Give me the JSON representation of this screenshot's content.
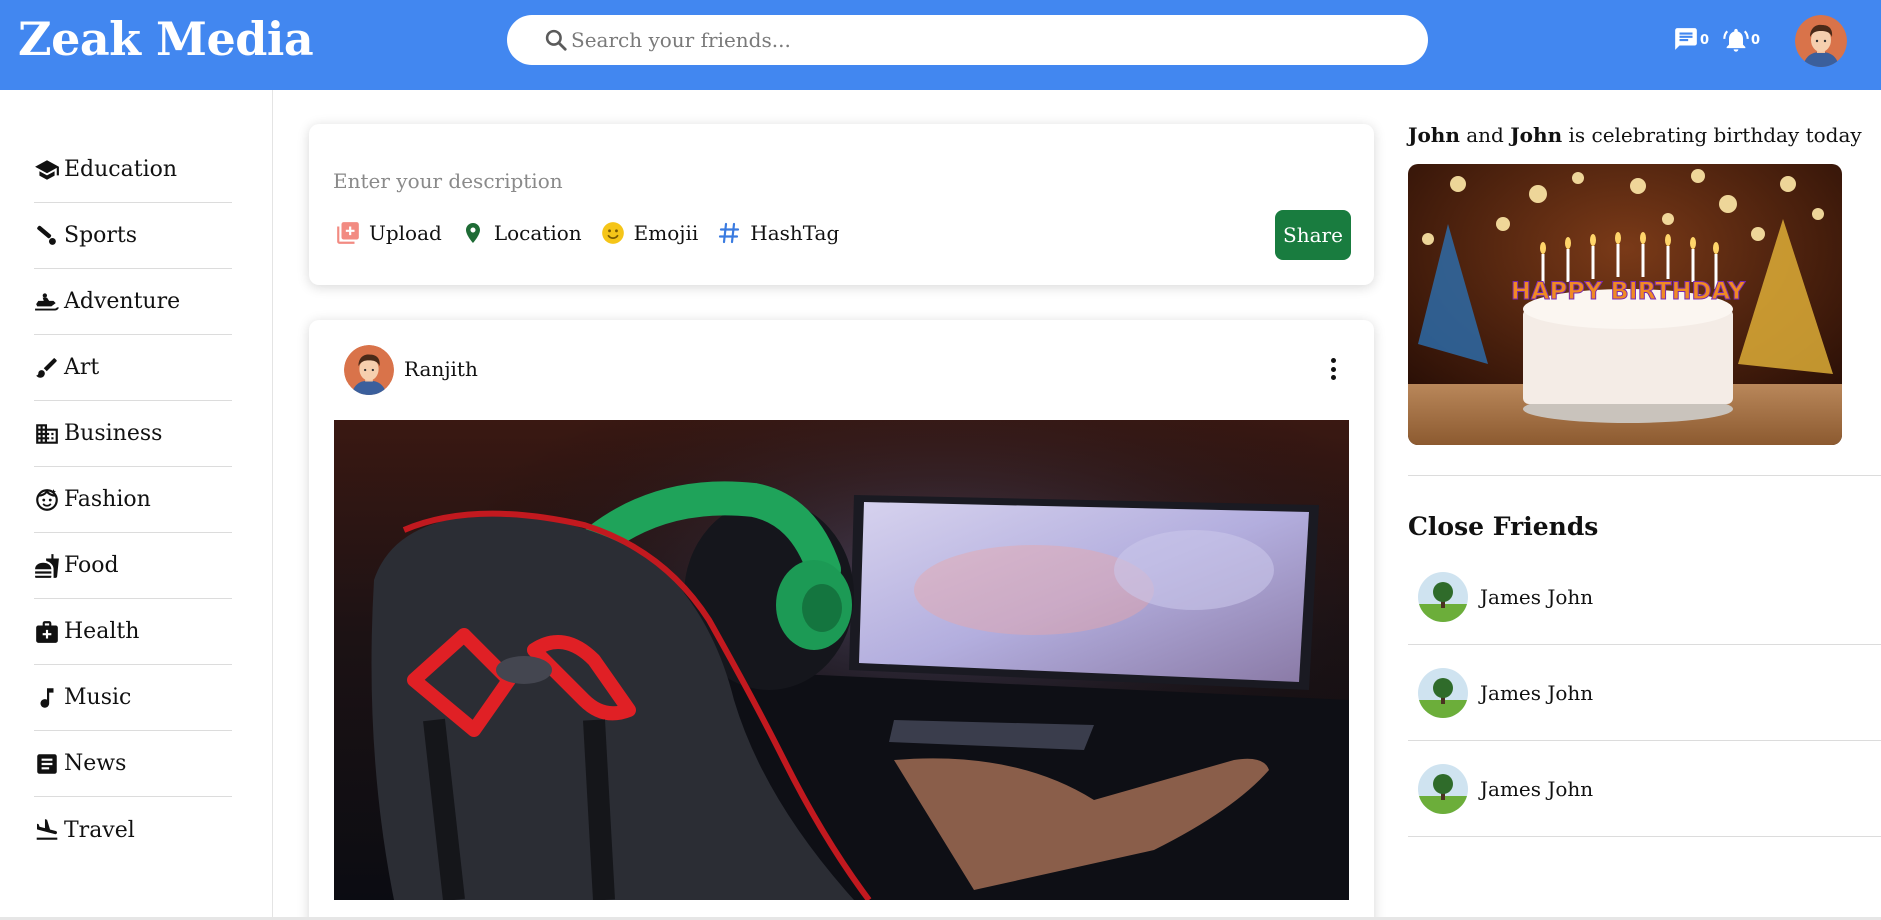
{
  "app": {
    "logo": "Zeak Media",
    "brand_color": "#4287f0",
    "share_color": "#197c3f"
  },
  "header": {
    "search_placeholder": "Search your friends...",
    "messages_count": "0",
    "notifications_count": "0"
  },
  "sidebar": {
    "items": [
      {
        "label": "Education",
        "icon": "graduation-cap-icon"
      },
      {
        "label": "Sports",
        "icon": "sports-icon"
      },
      {
        "label": "Adventure",
        "icon": "snowmobile-icon"
      },
      {
        "label": "Art",
        "icon": "brush-icon"
      },
      {
        "label": "Business",
        "icon": "building-icon"
      },
      {
        "label": "Fashion",
        "icon": "face-icon"
      },
      {
        "label": "Food",
        "icon": "fastfood-icon"
      },
      {
        "label": "Health",
        "icon": "medical-bag-icon"
      },
      {
        "label": "Music",
        "icon": "music-note-icon"
      },
      {
        "label": "News",
        "icon": "article-icon"
      },
      {
        "label": "Travel",
        "icon": "flight-land-icon"
      }
    ]
  },
  "composer": {
    "placeholder": "Enter your description",
    "tools": [
      {
        "label": "Upload",
        "icon": "add-photo-icon"
      },
      {
        "label": "Location",
        "icon": "location-pin-icon"
      },
      {
        "label": "Emojii",
        "icon": "emoji-icon"
      },
      {
        "label": "HashTag",
        "icon": "hashtag-icon"
      }
    ],
    "share_label": "Share"
  },
  "post": {
    "author": "Ranjith"
  },
  "birthday": {
    "name1": "John",
    "conj": "and",
    "name2": "John",
    "suffix": "is celebrating birthday today",
    "cake_text": "HAPPY BIRTHDAY"
  },
  "close_friends": {
    "title": "Close Friends",
    "friends": [
      {
        "name": "James John"
      },
      {
        "name": "James John"
      },
      {
        "name": "James John"
      }
    ]
  }
}
